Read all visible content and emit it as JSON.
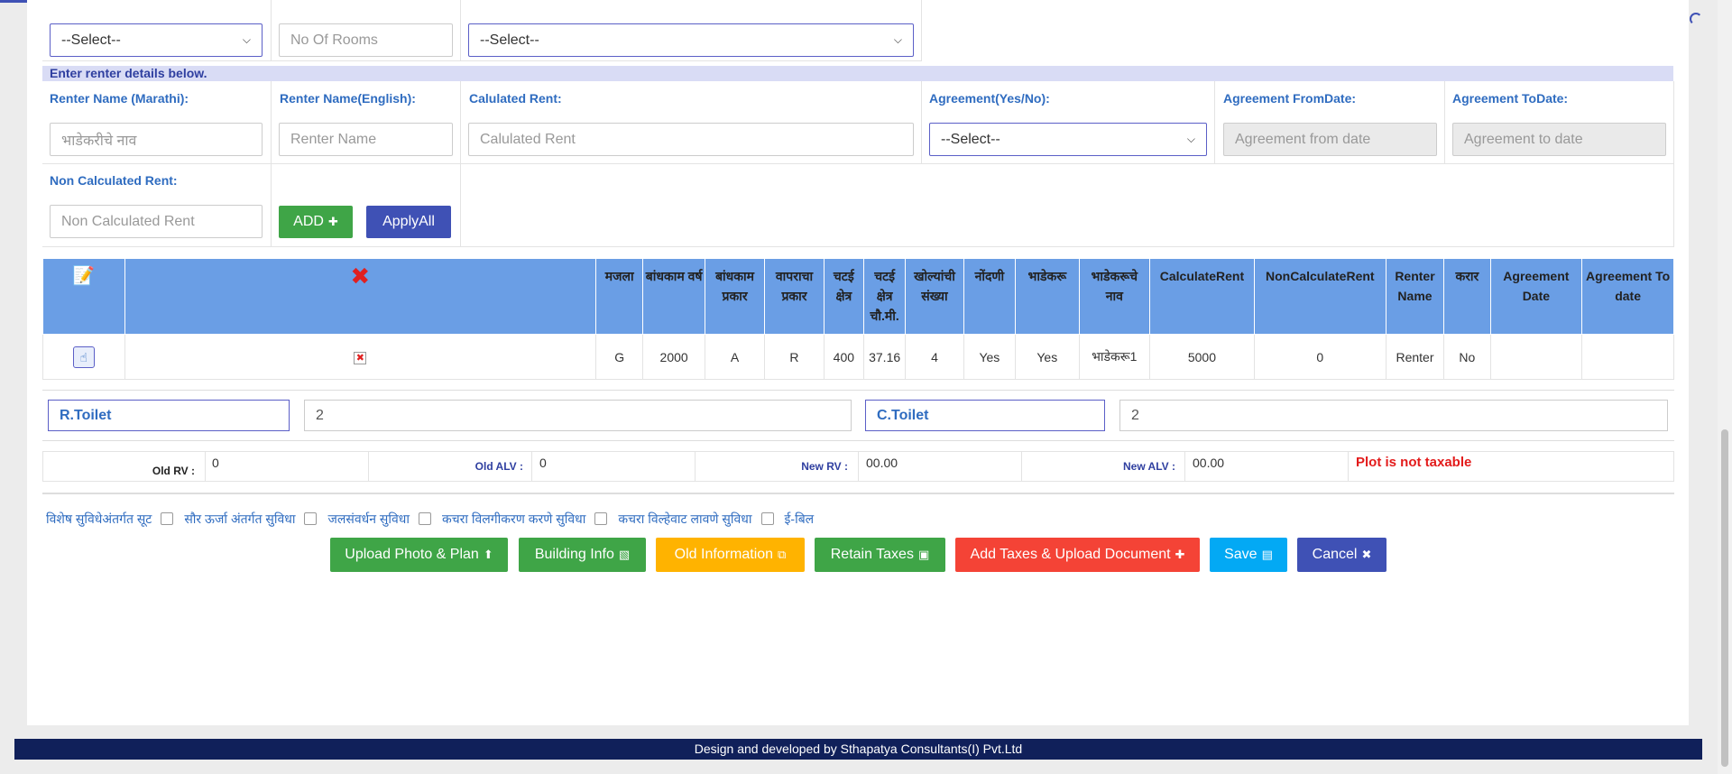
{
  "top_row": {
    "select1": "--Select--",
    "rooms_placeholder": "No Of Rooms",
    "select2": "--Select--"
  },
  "banner": "Enter renter details below.",
  "renter_form": {
    "label_marathi": "Renter Name (Marathi):",
    "label_english": "Renter Name(English):",
    "label_calc_rent": "Calulated Rent:",
    "label_agreement": "Agreement(Yes/No):",
    "label_from_date": "Agreement FromDate:",
    "label_to_date": "Agreement ToDate:",
    "label_non_calc": "Non Calculated Rent:",
    "ph_marathi": "भाडेकरीचे नाव",
    "ph_english": "Renter Name",
    "ph_calc_rent": "Calulated Rent",
    "agreement_select": "--Select--",
    "ph_from_date": "Agreement from date",
    "ph_to_date": "Agreement to date",
    "ph_non_calc": "Non Calculated Rent",
    "add_label": "ADD",
    "apply_all_label": "ApplyAll"
  },
  "table": {
    "headers": [
      "मजला",
      "बांधकाम वर्ष",
      "बांधकाम प्रकार",
      "वापराचा प्रकार",
      "चटई क्षेत्र",
      "चटई क्षेत्र चौ.मी.",
      "खोल्यांची संख्या",
      "नोंदणी",
      "भाडेकरू",
      "भाडेकरूचे नाव",
      "CalculateRent",
      "NonCalculateRent",
      "Renter Name",
      "करार",
      "Agreement Date",
      "Agreement To date"
    ],
    "row": [
      "G",
      "2000",
      "A",
      "R",
      "400",
      "37.16",
      "4",
      "Yes",
      "Yes",
      "भाडेकरू1",
      "5000",
      "0",
      "Renter",
      "No",
      "",
      ""
    ]
  },
  "toilets": {
    "r_label": "R.Toilet",
    "r_value": "2",
    "c_label": "C.Toilet",
    "c_value": "2"
  },
  "rv": {
    "old_rv_label": "Old RV :",
    "old_rv_value": "0",
    "old_alv_label": "Old ALV :",
    "old_alv_value": "0",
    "new_rv_label": "New RV :",
    "new_rv_value": "00.00",
    "new_alv_label": "New ALV :",
    "new_alv_value": "00.00",
    "status": "Plot is not taxable"
  },
  "facilities": {
    "title": "विशेष सुविधेअंतर्गत सूट",
    "items": [
      "सौर ऊर्जा अंतर्गत सुविधा",
      "जलसंवर्धन सुविधा",
      "कचरा विलगीकरण करणे सुविधा",
      "कचरा विल्हेवाट लावणे सुविधा",
      "ई-बिल"
    ]
  },
  "actions": {
    "upload_photo": "Upload Photo & Plan",
    "building_info": "Building Info",
    "old_information": "Old Information",
    "retain_taxes": "Retain Taxes",
    "add_taxes": "Add Taxes & Upload Document",
    "save": "Save",
    "cancel": "Cancel"
  },
  "footer": "Design and developed by Sthapatya Consultants(I) Pvt.Ltd",
  "colors": {
    "green": "#3fa547",
    "indigo": "#3f51b5",
    "amber": "#ffb300",
    "red": "#f44336",
    "sky": "#03a9f4",
    "header_blue": "#6a9ee5",
    "footer_navy": "#10205a"
  }
}
